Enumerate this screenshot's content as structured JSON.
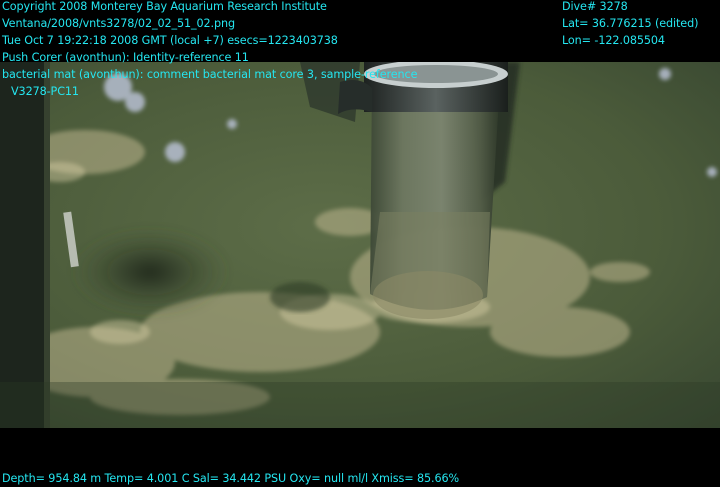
{
  "overlay": {
    "top_left": [
      "Copyright 2008 Monterey Bay Aquarium Research Institute",
      "Ventana/2008/vnts3278/02_02_51_02.png",
      "Tue Oct  7 19:22:18 2008 GMT (local +7)  esecs=1223403738",
      "Push Corer (avonthun): Identity-reference 11",
      "bacterial mat (avonthun): comment bacterial mat core 3, sample-reference",
      "V3278-PC11"
    ],
    "top_right": [
      "Dive# 3278",
      "Lat= 36.776215 (edited)",
      "Lon= -122.085504"
    ],
    "bottom": "Depth= 954.84 m  Temp= 4.001 C  Sal= 34.442 PSU  Oxy= null ml/l  Xmiss= 85.66%"
  },
  "colors": {
    "overlay_text": "#25e6f0",
    "seafloor": "#4d5f3c",
    "bacterial_mat": "#bdb58e",
    "letterbox": "#000000"
  }
}
